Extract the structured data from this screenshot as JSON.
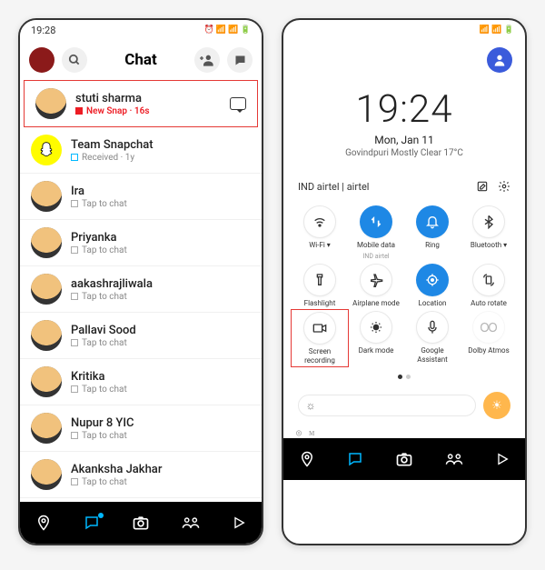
{
  "left": {
    "status": {
      "time": "19:28",
      "icons": "⏰ 📶 📶 🔋"
    },
    "header": {
      "title": "Chat"
    },
    "chats": [
      {
        "name": "stuti sharma",
        "status": "New Snap",
        "time": "16s",
        "highlighted": true,
        "new_snap": true
      },
      {
        "name": "Team Snapchat",
        "status": "Received",
        "time": "1y",
        "ghost": true,
        "received": true
      },
      {
        "name": "Ira",
        "status": "Tap to chat",
        "time": ""
      },
      {
        "name": "Priyanka",
        "status": "Tap to chat",
        "time": ""
      },
      {
        "name": "aakashrajliwala",
        "status": "Tap to chat",
        "time": ""
      },
      {
        "name": "Pallavi Sood",
        "status": "Tap to chat",
        "time": ""
      },
      {
        "name": "Kritika",
        "status": "Tap to chat",
        "time": ""
      },
      {
        "name": "Nupur 8 YIC",
        "status": "Tap to chat",
        "time": ""
      },
      {
        "name": "Akanksha Jakhar",
        "status": "Tap to chat",
        "time": ""
      }
    ]
  },
  "right": {
    "status_icons": "📶 📶 🔋",
    "clock": {
      "time": "19:24",
      "date": "Mon, Jan 11",
      "weather": "Govindpuri Mostly Clear 17°C"
    },
    "carrier": "IND airtel | airtel",
    "tiles": [
      {
        "label": "Wi-Fi",
        "sublabel": "",
        "active": false,
        "icon": "wifi",
        "dropdown": true
      },
      {
        "label": "Mobile data",
        "sublabel": "IND airtel",
        "active": true,
        "icon": "data",
        "dropdown": false
      },
      {
        "label": "Ring",
        "sublabel": "",
        "active": true,
        "icon": "bell",
        "dropdown": false
      },
      {
        "label": "Bluetooth",
        "sublabel": "",
        "active": false,
        "icon": "bluetooth",
        "dropdown": true
      },
      {
        "label": "Flashlight",
        "sublabel": "",
        "active": false,
        "icon": "flashlight",
        "dropdown": false
      },
      {
        "label": "Airplane mode",
        "sublabel": "",
        "active": false,
        "icon": "airplane",
        "dropdown": false
      },
      {
        "label": "Location",
        "sublabel": "",
        "active": true,
        "icon": "location",
        "dropdown": false
      },
      {
        "label": "Auto rotate",
        "sublabel": "",
        "active": false,
        "icon": "rotate",
        "dropdown": false
      },
      {
        "label": "Screen recording",
        "sublabel": "",
        "active": false,
        "icon": "camera",
        "dropdown": false,
        "highlighted": true
      },
      {
        "label": "Dark mode",
        "sublabel": "",
        "active": false,
        "icon": "dark",
        "dropdown": false
      },
      {
        "label": "Google Assistant",
        "sublabel": "",
        "active": false,
        "icon": "mic",
        "dropdown": false
      },
      {
        "label": "Dolby Atmos",
        "sublabel": "",
        "active": false,
        "icon": "dolby",
        "dropdown": false,
        "disabled": true
      }
    ],
    "alt": {
      "google": "◎",
      "lens": "ᴍ"
    }
  }
}
